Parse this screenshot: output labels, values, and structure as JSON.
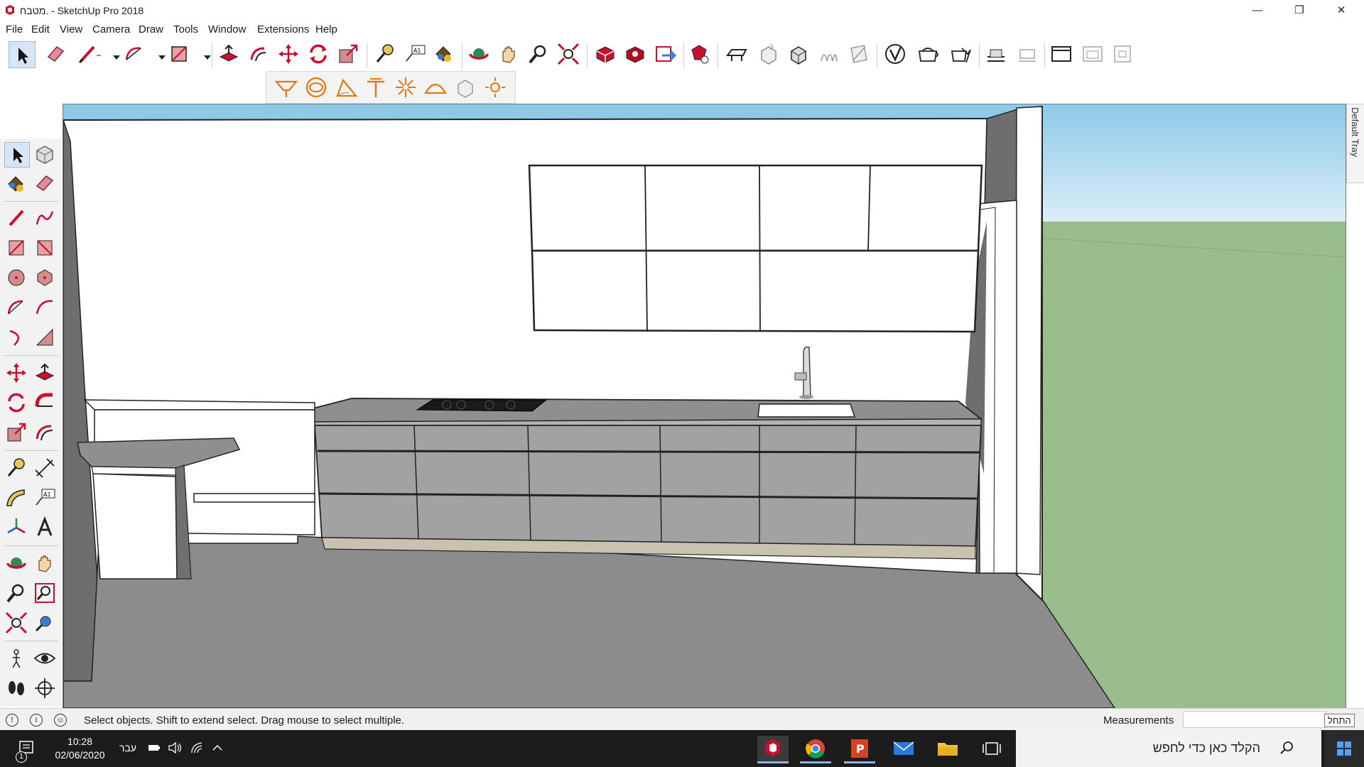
{
  "window": {
    "title": "מטבח. - SketchUp Pro 2018",
    "minimize_label": "—",
    "restore_label": "❐",
    "close_label": "✕"
  },
  "menu": [
    "File",
    "Edit",
    "View",
    "Camera",
    "Draw",
    "Tools",
    "Window",
    "Extensions",
    "Help"
  ],
  "tray": {
    "label": "Default Tray"
  },
  "status": {
    "message": "Select objects. Shift to extend select. Drag mouse to select multiple.",
    "measurements_label": "Measurements",
    "measurements_value": "",
    "tooltip": "התחל"
  },
  "taskbar": {
    "time": "10:28",
    "date": "02/06/2020",
    "language": "עבר",
    "search_placeholder": "הקלד כאן כדי לחפש",
    "notification_count": "1"
  },
  "colors": {
    "sky": "#8ec9e8",
    "ground": "#99be8c",
    "floor": "#8c8c8c",
    "cabinet": "#a2a2a2",
    "wall_dark": "#6e6e6e",
    "toolbar_accent": "#c8102e"
  },
  "icons": {
    "toolbar_main": [
      "select-icon",
      "eraser-icon",
      "line-icon",
      "arc-icon",
      "rectangle-icon",
      "push-pull-icon",
      "offset-icon",
      "move-icon",
      "rotate-icon",
      "scale-icon",
      "tape-measure-icon",
      "text-icon",
      "paint-bucket-icon",
      "orbit-icon",
      "pan-icon",
      "zoom-icon",
      "zoom-extents-icon",
      "3d-warehouse-icon",
      "extension-warehouse-icon",
      "send-to-layout-icon",
      "extension-manager-icon",
      "section-plane-icon",
      "display-section-icon",
      "section-cuts-icon",
      "section-fill-icon",
      "x-ray-icon",
      "back-edges-icon",
      "wireframe-icon",
      "hidden-line-icon",
      "shaded-icon",
      "shaded-textures-icon",
      "monochrome-icon"
    ],
    "toolbar_sandbox": [
      "from-contours-icon",
      "from-scratch-icon",
      "smoove-icon",
      "stamp-icon",
      "drape-icon",
      "add-detail-icon",
      "flip-edge-icon"
    ]
  }
}
